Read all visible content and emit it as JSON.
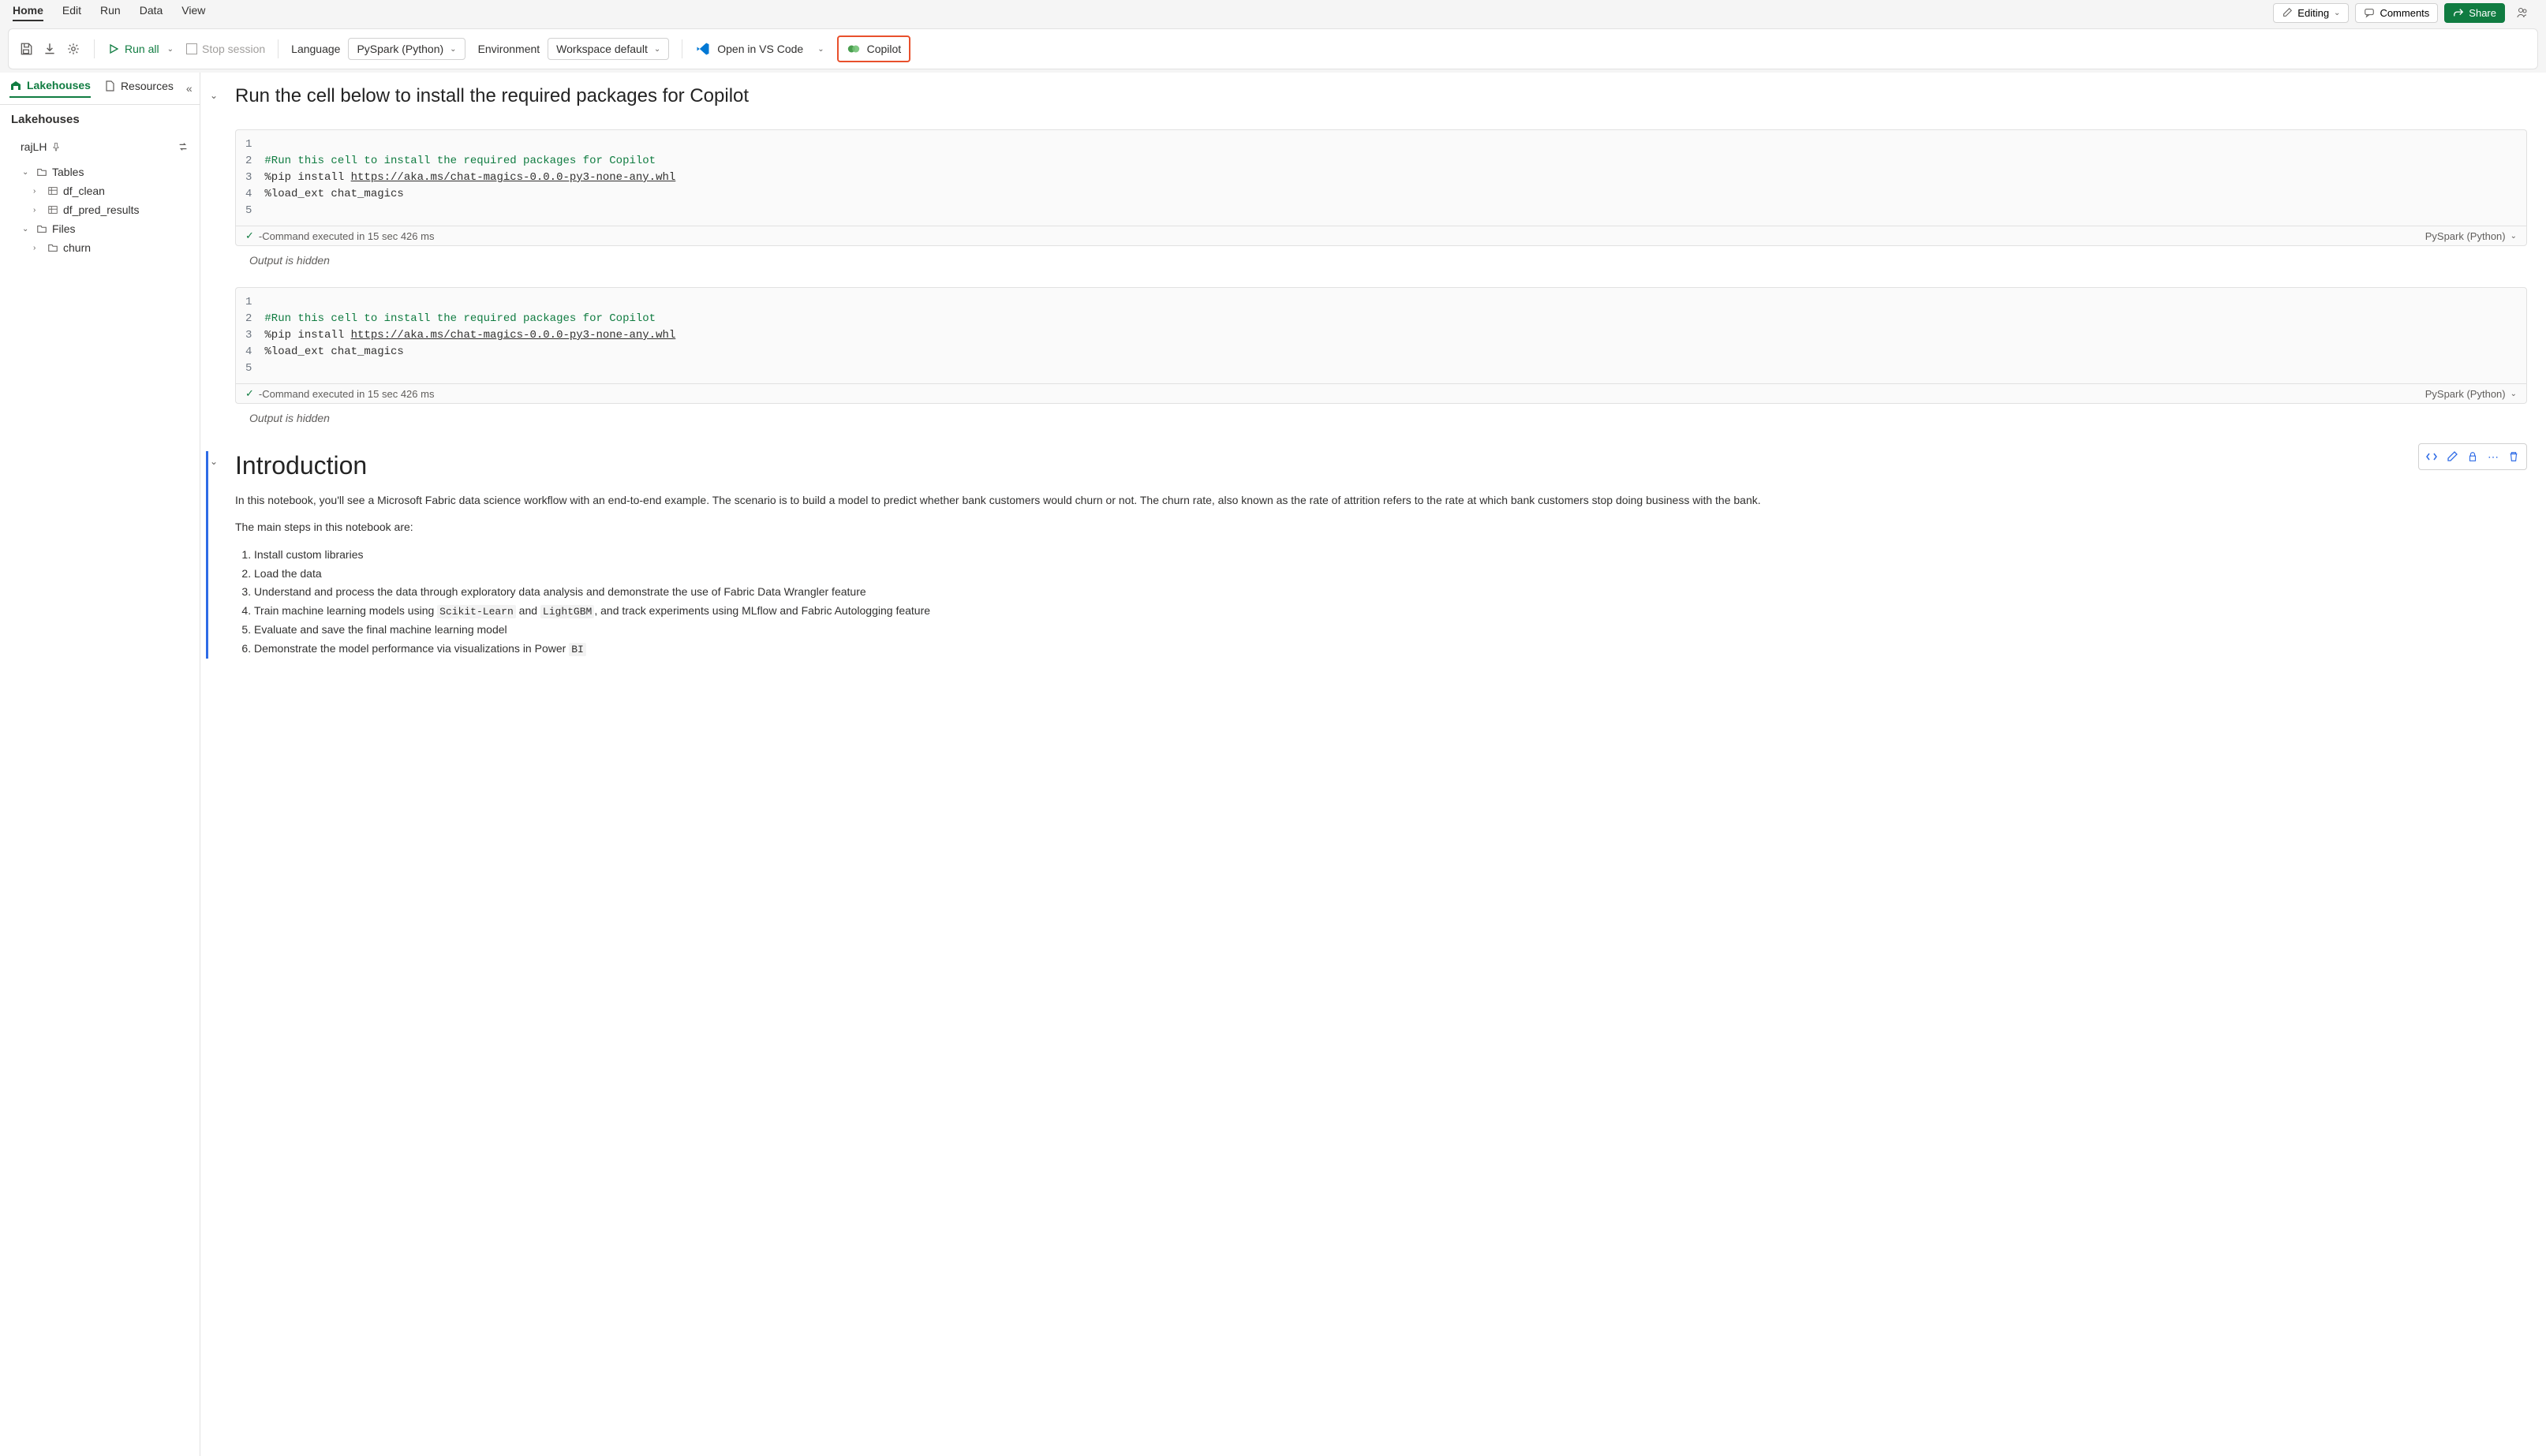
{
  "menubar": {
    "items": [
      "Home",
      "Edit",
      "Run",
      "Data",
      "View"
    ],
    "editing": "Editing",
    "comments": "Comments",
    "share": "Share"
  },
  "toolbar": {
    "run_all": "Run all",
    "stop_session": "Stop session",
    "language_label": "Language",
    "language_value": "PySpark (Python)",
    "environment_label": "Environment",
    "environment_value": "Workspace default",
    "open_vscode": "Open in VS Code",
    "copilot": "Copilot"
  },
  "sidebar": {
    "tabs": {
      "lakehouses": "Lakehouses",
      "resources": "Resources"
    },
    "header": "Lakehouses",
    "lakehouse_name": "rajLH",
    "tree": {
      "tables": "Tables",
      "table_items": [
        "df_clean",
        "df_pred_results"
      ],
      "files": "Files",
      "file_items": [
        "churn"
      ]
    }
  },
  "notebook": {
    "heading1": "Run the cell below to install the required packages for Copilot",
    "cell1": {
      "lines": [
        "1",
        "2",
        "3",
        "4",
        "5"
      ],
      "comment": "#Run this cell to install the required packages for Copilot",
      "pip_line_prefix": "%pip install ",
      "pip_url": "https://aka.ms/chat-magics-0.0.0-py3-none-any.whl",
      "load_ext": "%load_ext chat_magics",
      "status": "-Command executed in 15 sec 426 ms",
      "lang": "PySpark (Python)",
      "output": "Output is hidden"
    },
    "cell2": {
      "lines": [
        "1",
        "2",
        "3",
        "4",
        "5"
      ],
      "comment": "#Run this cell to install the required packages for Copilot",
      "pip_line_prefix": "%pip install ",
      "pip_url": "https://aka.ms/chat-magics-0.0.0-py3-none-any.whl",
      "load_ext": "%load_ext chat_magics",
      "status": "-Command executed in 15 sec 426 ms",
      "lang": "PySpark (Python)",
      "output": "Output is hidden"
    },
    "intro": {
      "title": "Introduction",
      "p1": "In this notebook, you'll see a Microsoft Fabric data science workflow with an end-to-end example. The scenario is to build a model to predict whether bank customers would churn or not. The churn rate, also known as the rate of attrition refers to the rate at which bank customers stop doing business with the bank.",
      "p2": "The main steps in this notebook are:",
      "steps": [
        "Install custom libraries",
        "Load the data",
        "Understand and process the data through exploratory data analysis and demonstrate the use of Fabric Data Wrangler feature",
        {
          "pre": "Train machine learning models using ",
          "c1": "Scikit-Learn",
          "mid": " and ",
          "c2": "LightGBM",
          "post": ", and track experiments using MLflow and Fabric Autologging feature"
        },
        "Evaluate and save the final machine learning model",
        {
          "pre": "Demonstrate the model performance via visualizations in Power ",
          "c1": "BI"
        }
      ]
    }
  }
}
